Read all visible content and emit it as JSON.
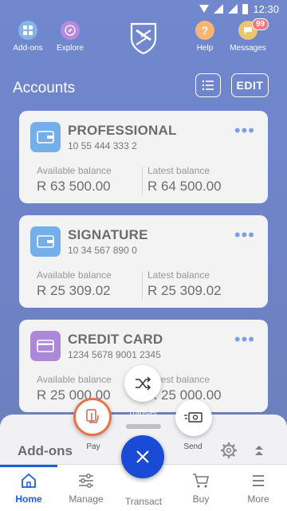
{
  "status_bar": {
    "time": "12:30"
  },
  "top_nav": {
    "addons_label": "Add-ons",
    "explore_label": "Explore",
    "help_label": "Help",
    "messages_label": "Messages",
    "messages_badge": "99"
  },
  "header": {
    "title": "Accounts",
    "edit_label": "EDIT"
  },
  "accounts": [
    {
      "name": "PROFESSIONAL",
      "number": "10 55 444 333 2",
      "available_label": "Available balance",
      "available": "R 63 500.00",
      "latest_label": "Latest balance",
      "latest": "R 64 500.00",
      "icon": "wallet-icon",
      "color": "#1f7fe0"
    },
    {
      "name": "SIGNATURE",
      "number": "10 34 567 890 0",
      "available_label": "Available balance",
      "available": "R 25 309.02",
      "latest_label": "Latest balance",
      "latest": "R 25 309.02",
      "icon": "wallet-icon",
      "color": "#1f7fe0"
    },
    {
      "name": "CREDIT CARD",
      "number": "1234 5678 9001 2345",
      "available_label": "Available balance",
      "available": "R 25 000.00",
      "latest_label": "Latest balance",
      "latest": "R 25 000.00",
      "icon": "credit-card-icon",
      "color": "#7a3fc0"
    }
  ],
  "more_glyph": "•••",
  "bottom_sheet": {
    "title": "Add-ons"
  },
  "fab_menu": {
    "transfer_label": "Transfer",
    "pay_label": "Pay",
    "send_label": "Send"
  },
  "tabs": [
    {
      "label": "Home",
      "active": true
    },
    {
      "label": "Manage",
      "active": false
    },
    {
      "label": "Transact",
      "active": false
    },
    {
      "label": "Buy",
      "active": false
    },
    {
      "label": "More",
      "active": false
    }
  ],
  "colors": {
    "brand": "#1a3fb0",
    "accent": "#1a5ee0",
    "badge": "#e0242e",
    "pay_ring": "#e8734a"
  }
}
